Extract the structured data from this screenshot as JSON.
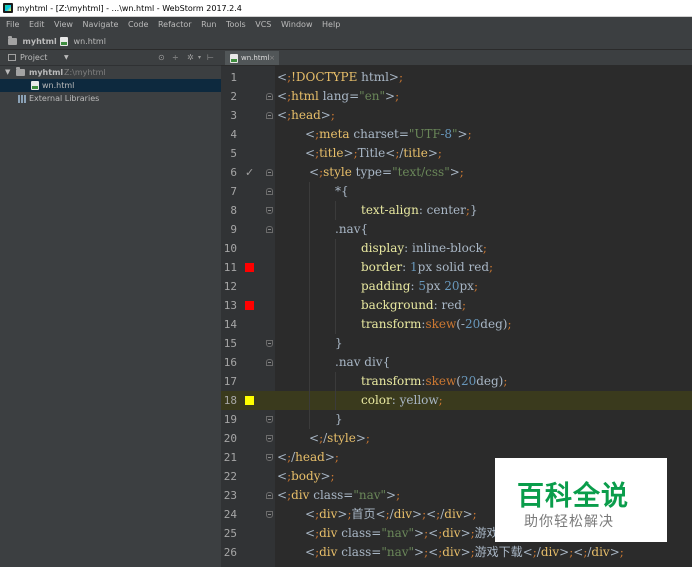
{
  "window": {
    "title": "myhtml - [Z:\\myhtml] - ...\\wn.html - WebStorm 2017.2.4"
  },
  "menu": [
    "File",
    "Edit",
    "View",
    "Navigate",
    "Code",
    "Refactor",
    "Run",
    "Tools",
    "VCS",
    "Window",
    "Help"
  ],
  "breadcrumb": {
    "project": "myhtml",
    "file": "wn.html"
  },
  "project_panel": {
    "label": "Project",
    "tree": [
      {
        "label": "myhtml",
        "path": "Z:\\myhtml"
      },
      {
        "label": "wn.html"
      },
      {
        "label": "External Libraries"
      }
    ]
  },
  "editor": {
    "tab": "wn.html",
    "highlight_line": 18,
    "marker_colors": {
      "red": "#ff0000",
      "yellow": "#ffff00"
    },
    "lines": [
      {
        "n": "1",
        "text": "<!DOCTYPE html>"
      },
      {
        "n": "2",
        "text": "<html lang=\"en\">"
      },
      {
        "n": "3",
        "text": "<head>"
      },
      {
        "n": "4",
        "text": "<meta charset=\"UTF-8\">"
      },
      {
        "n": "5",
        "text": "<title>Title</title>"
      },
      {
        "n": "6",
        "text": "<style type=\"text/css\">"
      },
      {
        "n": "7",
        "text": "*{"
      },
      {
        "n": "8",
        "text": "text-align: center;}"
      },
      {
        "n": "9",
        "text": ".nav{"
      },
      {
        "n": "10",
        "text": "display: inline-block;"
      },
      {
        "n": "11",
        "text": "border: 1px solid red;"
      },
      {
        "n": "12",
        "text": "padding: 5px 20px;"
      },
      {
        "n": "13",
        "text": "background: red;"
      },
      {
        "n": "14",
        "text": "transform:skew(-20deg);"
      },
      {
        "n": "15",
        "text": "}"
      },
      {
        "n": "16",
        "text": ".nav div{"
      },
      {
        "n": "17",
        "text": "transform:skew(20deg);"
      },
      {
        "n": "18",
        "text": "color: yellow;"
      },
      {
        "n": "19",
        "text": "}"
      },
      {
        "n": "20",
        "text": "</style>"
      },
      {
        "n": "21",
        "text": "</head>"
      },
      {
        "n": "22",
        "text": "<body>"
      },
      {
        "n": "23",
        "text": "<div class=\"nav\">"
      },
      {
        "n": "24",
        "text": "<div>首页</div></div>"
      },
      {
        "n": "25",
        "text": "<div class=\"nav\"><div>游戏简介"
      },
      {
        "n": "26",
        "text": "<div class=\"nav\"><div>游戏下载</div></div>"
      }
    ]
  },
  "watermark": {
    "title": "百科全说",
    "subtitle": "助你轻松解决"
  }
}
